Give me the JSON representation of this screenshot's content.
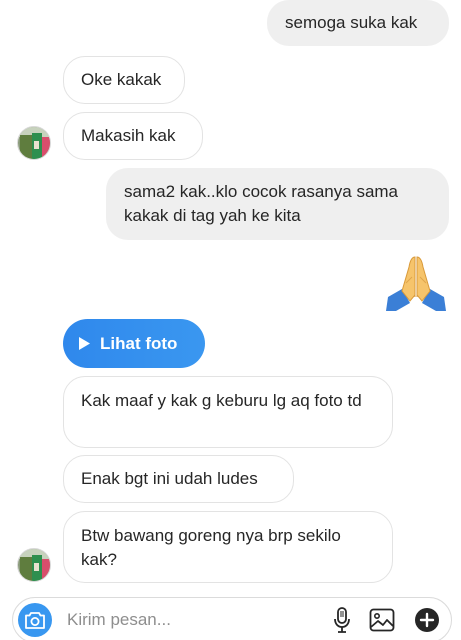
{
  "messages": [
    {
      "side": "out",
      "text": "semoga suka kak"
    },
    {
      "side": "in",
      "text": "Oke kakak"
    },
    {
      "side": "in",
      "text": "Makasih kak"
    },
    {
      "side": "out",
      "text": "sama2 kak..klo cocok rasanya sama kakak di tag yah ke kita"
    },
    {
      "side": "out",
      "type": "emoji",
      "emoji": "folded-hands"
    },
    {
      "side": "in",
      "type": "action",
      "text": "Lihat foto"
    },
    {
      "side": "in",
      "text": "Kak maaf y kak g keburu lg aq foto td"
    },
    {
      "side": "in",
      "text": "Enak bgt ini udah ludes"
    },
    {
      "side": "in",
      "text": "Btw bawang goreng nya brp sekilo kak?"
    }
  ],
  "composer": {
    "placeholder": "Kirim pesan...",
    "icons": [
      "camera-icon",
      "microphone-icon",
      "gallery-icon",
      "plus-icon"
    ]
  },
  "colors": {
    "outgoing_bubble": "#efefef",
    "incoming_border": "#e3e3e3",
    "accent": "#3897f0",
    "text": "#262626",
    "placeholder": "#8e8e8e"
  }
}
